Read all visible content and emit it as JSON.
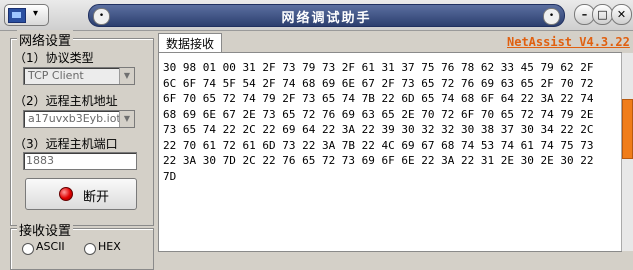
{
  "window": {
    "title": "网络调试助手",
    "version": "NetAssist V4.3.22",
    "controls": {
      "minimize": "–",
      "maximize": "□",
      "close": "✕"
    }
  },
  "network_settings": {
    "title": "网络设置",
    "protocol_label": "（1）协议类型",
    "protocol_value": "TCP Client",
    "remote_host_label": "（2）远程主机地址",
    "remote_host_value": "a17uvxb3Eyb.iot-",
    "remote_port_label": "（3）远程主机端口",
    "remote_port_value": "1883",
    "disconnect_label": "断开"
  },
  "receive_settings": {
    "title": "接收设置",
    "options": [
      "ASCII",
      "HEX"
    ]
  },
  "tab": {
    "label": "数据接收"
  },
  "received_data": "30 98 01 00 31 2F 73 79 73 2F 61 31 37 75 76 78 62 33 45 79 62 2F 6C 6F 74 5F 54 2F 74 68 69 6E 67 2F 73 65 72 76 69 63 65 2F 70 72 6F 70 65 72 74 79 2F 73 65 74 7B 22 6D 65 74 68 6F 64 22 3A 22 74 68 69 6E 67 2E 73 65 72 76 69 63 65 2E 70 72 6F 70 65 72 74 79 2E 73 65 74 22 2C 22 69 64 22 3A 22 39 30 32 32 30 38 37 30 34 22 2C 22 70 61 72 61 6D 73 22 3A 7B 22 4C 69 67 68 74 53 74 61 74 75 73 22 3A 30 7D 2C 22 76 65 72 73 69 6F 6E 22 3A 22 31 2E 30 2E 30 22 7D",
  "colors": {
    "accent_version": "#e06010",
    "scroll_thumb": "#f07d1a",
    "title_bar": "#2c3f6f"
  }
}
